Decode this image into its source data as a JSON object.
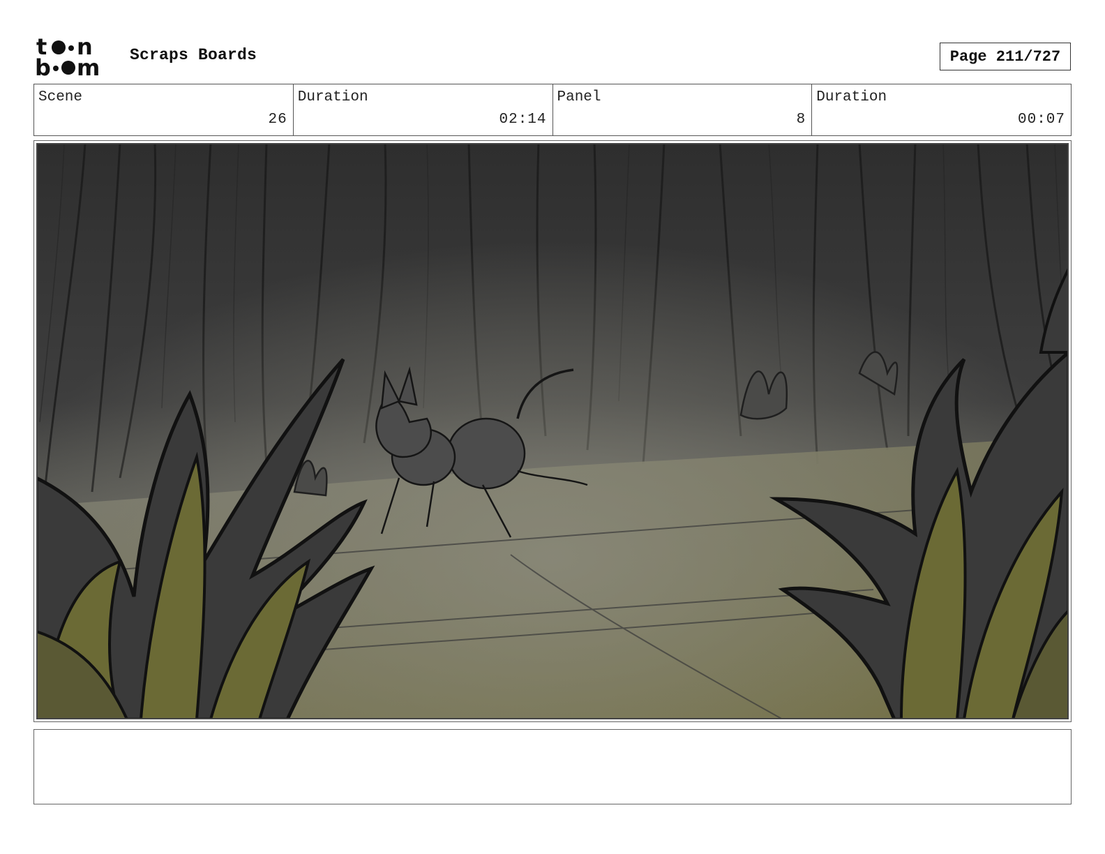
{
  "header": {
    "logo_text": "toon boom",
    "title": "Scraps Boards",
    "page_indicator": "Page 211/727"
  },
  "info": {
    "scene_label": "Scene",
    "scene_value": "26",
    "scene_duration_label": "Duration",
    "scene_duration_value": "02:14",
    "panel_label": "Panel",
    "panel_value": "8",
    "panel_duration_label": "Duration",
    "panel_duration_value": "00:07"
  },
  "panel": {
    "description": "",
    "colors": {
      "forest_dark": "#2b2b2b",
      "forest_mid": "#4a4a4a",
      "ground_light": "#8a8a7a",
      "ground_olive": "#6f6b3a",
      "plant_olive": "#6b6a35",
      "plant_dark": "#3a3a3a"
    }
  },
  "notes": {
    "text": ""
  }
}
